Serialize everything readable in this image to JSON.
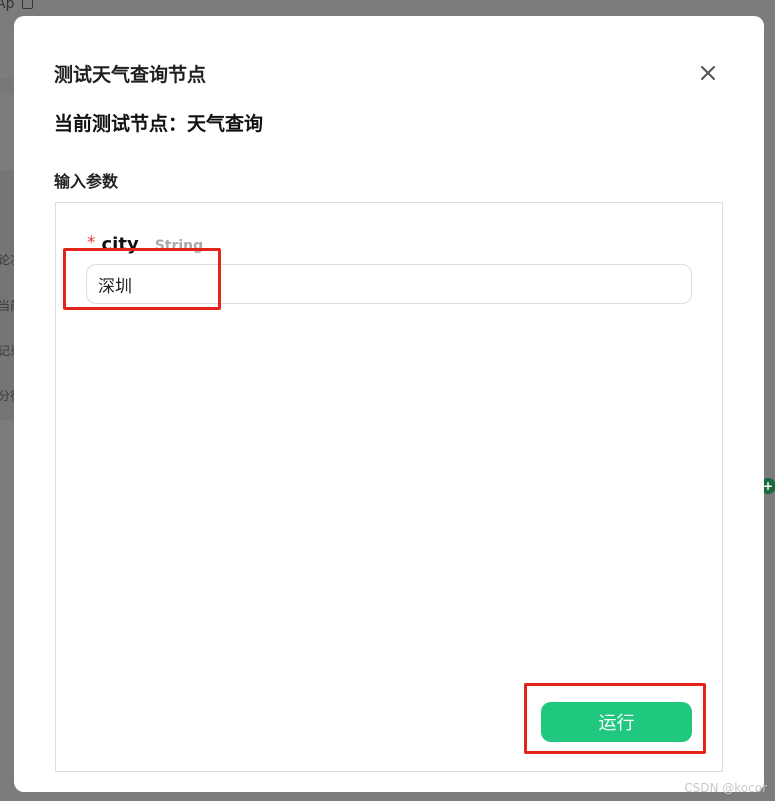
{
  "background": {
    "top_fragment": "Ap",
    "side_fragments": [
      "论次",
      "当前",
      "记录",
      "分行"
    ]
  },
  "dialog": {
    "title": "测试天气查询节点",
    "current_node_label": "当前测试节点：天气查询",
    "section_label": "输入参数",
    "fields": [
      {
        "required_mark": "*",
        "name": "city",
        "type": "String",
        "value": "深圳"
      }
    ],
    "run_label": "运行"
  },
  "watermark": "CSDN @kocor",
  "colors": {
    "accent": "#20c77f",
    "annotation": "#e3241b",
    "required": "#e53935"
  }
}
